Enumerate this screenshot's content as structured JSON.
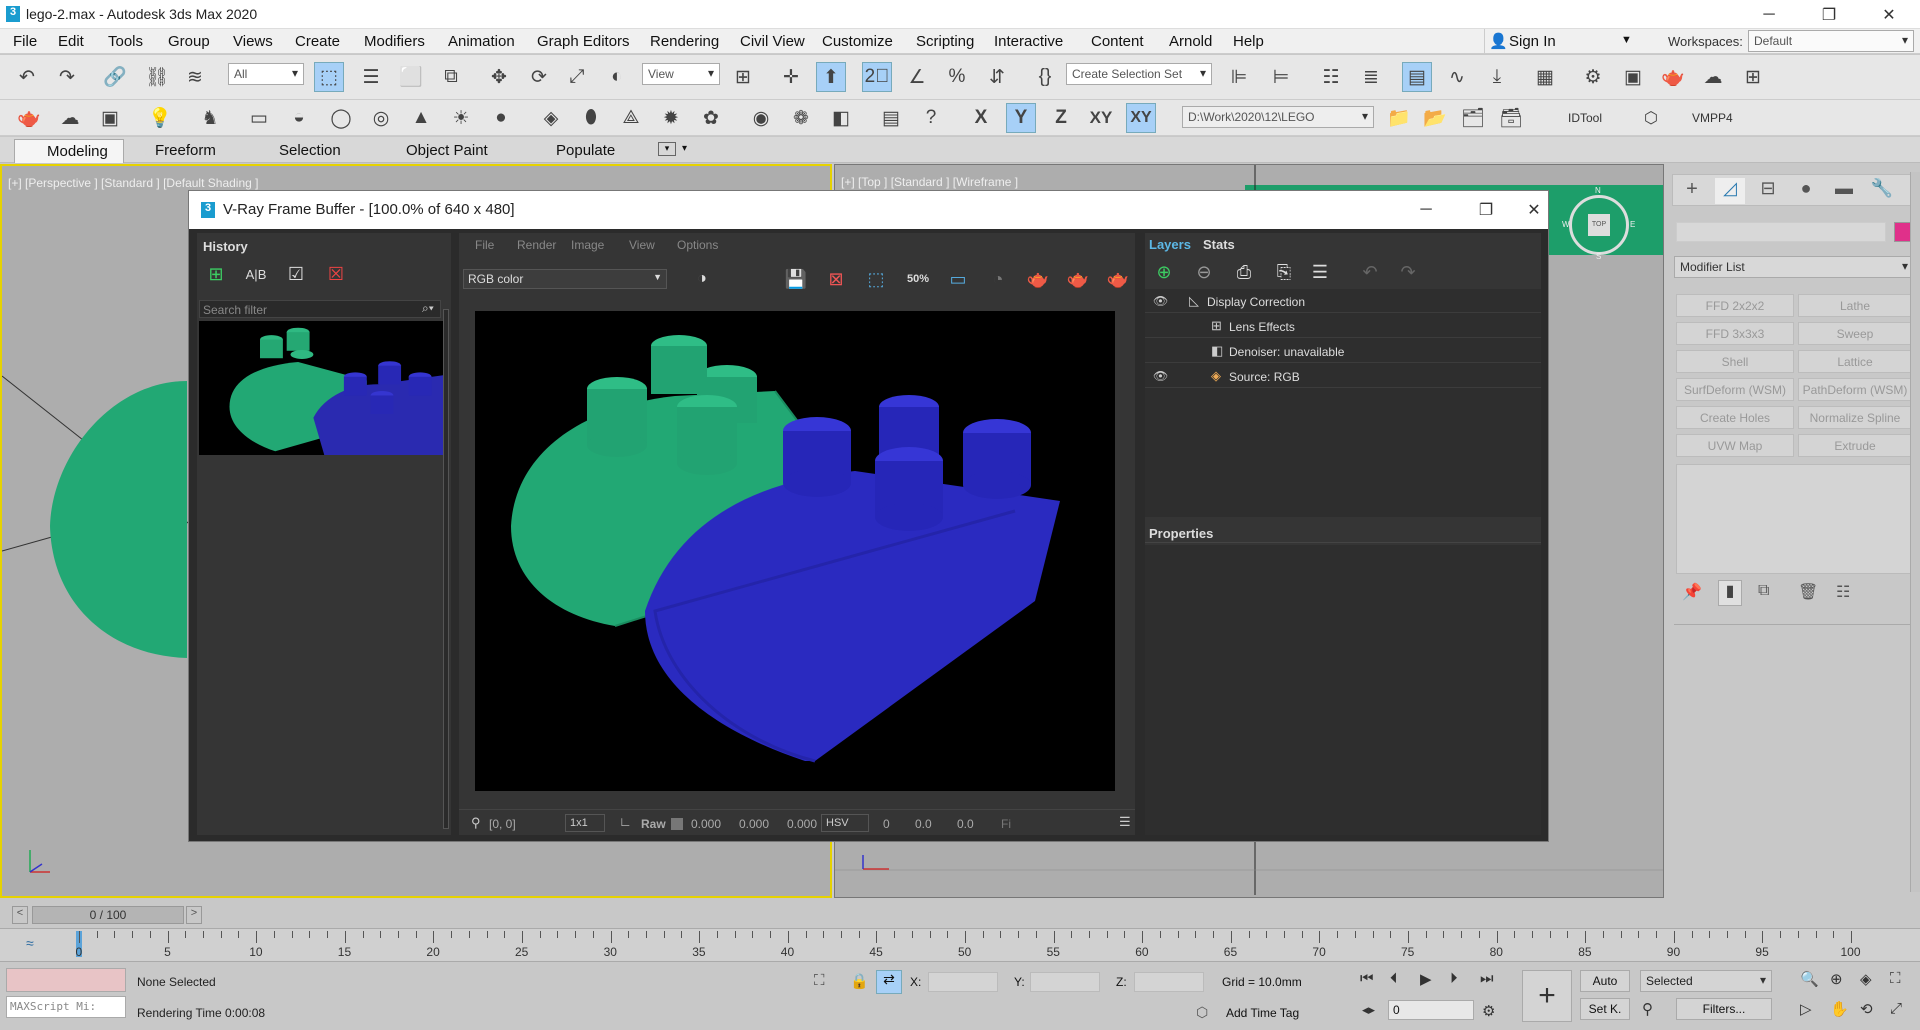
{
  "window": {
    "title": "lego-2.max - Autodesk 3ds Max 2020",
    "min": "─",
    "max": "❐",
    "close": "✕"
  },
  "menu": [
    "File",
    "Edit",
    "Tools",
    "Group",
    "Views",
    "Create",
    "Modifiers",
    "Animation",
    "Graph Editors",
    "Rendering",
    "Civil View",
    "Customize",
    "Scripting",
    "Interactive",
    "Content",
    "Arnold",
    "Help"
  ],
  "account": {
    "sign_in": "Sign In",
    "workspaces_label": "Workspaces:",
    "workspace": "Default"
  },
  "toolbar1": {
    "filter": "All",
    "ref_coord": "View",
    "selection_set": "Create Selection Set"
  },
  "toolbar2": {
    "axis_x": "X",
    "axis_y": "Y",
    "axis_z": "Z",
    "axis_xy": "XY",
    "project_path": "D:\\Work\\2020\\12\\LEGO",
    "idtool": "IDTool",
    "vmpp4": "VMPP4"
  },
  "ribbon_tabs": [
    "Modeling",
    "Freeform",
    "Selection",
    "Object Paint",
    "Populate"
  ],
  "viewports": {
    "left_label": "[+] [Perspective ] [Standard ] [Default Shading ]",
    "right_label": "[+] [Top ] [Standard ] [Wireframe ]",
    "viewcube": "TOP",
    "compass_n": "N",
    "compass_s": "S",
    "compass_e": "E",
    "compass_w": "W"
  },
  "vfb": {
    "title": "V-Ray Frame Buffer - [100.0% of 640 x 480]",
    "history_label": "History",
    "search_placeholder": "Search filter",
    "menu": [
      "File",
      "Render",
      "Image",
      "View",
      "Options"
    ],
    "channel": "RGB color",
    "zoom_badge": "50%",
    "layers_tab": "Layers",
    "stats_tab": "Stats",
    "layers": [
      "Display Correction",
      "Lens Effects",
      "Denoiser: unavailable",
      "Source: RGB"
    ],
    "properties_label": "Properties",
    "status": {
      "coords": "[0, 0]",
      "ratio": "1x1",
      "raw": "Raw",
      "v1": "0.000",
      "v2": "0.000",
      "v3": "0.000",
      "mode": "HSV",
      "h": "0",
      "s": "0.0",
      "v": "0.0",
      "fi": "Fi"
    }
  },
  "command_panel": {
    "modifier_list": "Modifier List",
    "buttons": [
      "FFD 2x2x2",
      "Lathe",
      "FFD 3x3x3",
      "Sweep",
      "Shell",
      "Lattice",
      "SurfDeform (WSM)",
      "PathDeform (WSM)",
      "Create Holes",
      "Normalize Spline",
      "UVW Map",
      "Extrude"
    ],
    "swatch_color": "#e0308a"
  },
  "timeline": {
    "frame": "0 / 100",
    "prev": "<",
    "next": ">",
    "ticks": [
      "0",
      "5",
      "10",
      "15",
      "20",
      "25",
      "30",
      "35",
      "40",
      "45",
      "50",
      "55",
      "60",
      "65",
      "70",
      "75",
      "80",
      "85",
      "90",
      "95",
      "100"
    ]
  },
  "status_bar": {
    "none_selected": "None Selected",
    "rendering_time": "Rendering Time  0:00:08",
    "maxscript": "MAXScript Mi:",
    "x_label": "X:",
    "y_label": "Y:",
    "z_label": "Z:",
    "grid": "Grid = 10.0mm",
    "add_time_tag": "Add Time Tag",
    "auto": "Auto",
    "set_key": "Set K.",
    "selected": "Selected",
    "filters": "Filters...",
    "frame_value": "0"
  }
}
